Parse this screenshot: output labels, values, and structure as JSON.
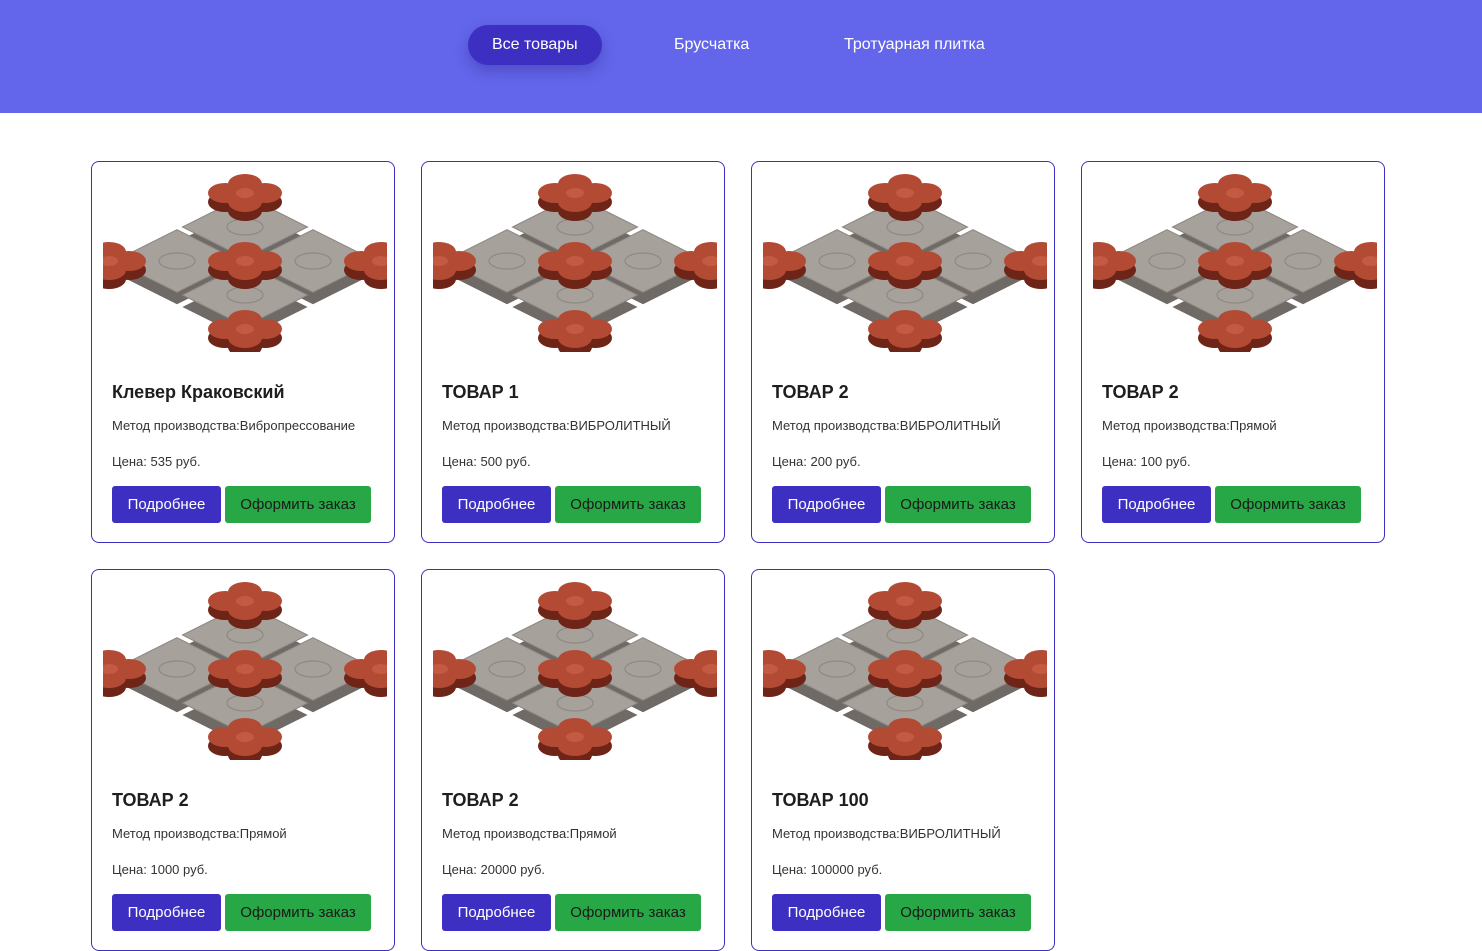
{
  "nav": {
    "tabs": [
      {
        "label": "Все товары",
        "active": true
      },
      {
        "label": "Брусчатка",
        "active": false
      },
      {
        "label": "Тротуарная плитка",
        "active": false
      }
    ]
  },
  "colors": {
    "header_bg": "#6366ea",
    "accent": "#3d2fc2",
    "order_button": "#27a745"
  },
  "products": [
    {
      "title": "Клевер Краковский",
      "method": "Метод производства:Вибропрессование",
      "price": "Цена: 535 руб.",
      "details_label": "Подробнее",
      "order_label": "Оформить заказ",
      "image_icon": "paving-tile-image"
    },
    {
      "title": "ТОВАР 1",
      "method": "Метод производства:ВИБРОЛИТНЫЙ",
      "price": "Цена: 500 руб.",
      "details_label": "Подробнее",
      "order_label": "Оформить заказ",
      "image_icon": "paving-tile-image"
    },
    {
      "title": "ТОВАР 2",
      "method": "Метод производства:ВИБРОЛИТНЫЙ",
      "price": "Цена: 200 руб.",
      "details_label": "Подробнее",
      "order_label": "Оформить заказ",
      "image_icon": "paving-tile-image"
    },
    {
      "title": "ТОВАР 2",
      "method": "Метод производства:Прямой",
      "price": "Цена: 100 руб.",
      "details_label": "Подробнее",
      "order_label": "Оформить заказ",
      "image_icon": "paving-tile-image"
    },
    {
      "title": "ТОВАР 2",
      "method": "Метод производства:Прямой",
      "price": "Цена: 1000 руб.",
      "details_label": "Подробнее",
      "order_label": "Оформить заказ",
      "image_icon": "paving-tile-image"
    },
    {
      "title": "ТОВАР 2",
      "method": "Метод производства:Прямой",
      "price": "Цена: 20000 руб.",
      "details_label": "Подробнее",
      "order_label": "Оформить заказ",
      "image_icon": "paving-tile-image"
    },
    {
      "title": "ТОВАР 100",
      "method": "Метод производства:ВИБРОЛИТНЫЙ",
      "price": "Цена: 100000 руб.",
      "details_label": "Подробнее",
      "order_label": "Оформить заказ",
      "image_icon": "paving-tile-image"
    }
  ]
}
